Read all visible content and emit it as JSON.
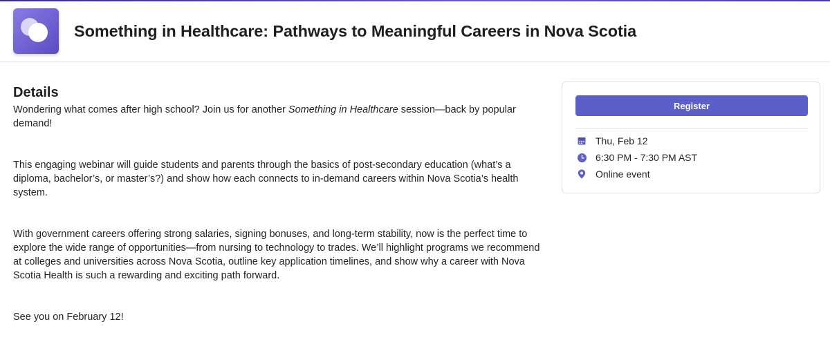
{
  "header": {
    "title": "Something in Healthcare: Pathways to Meaningful Careers in Nova Scotia",
    "logo_icon": "meeting-bubbles-icon"
  },
  "details": {
    "heading": "Details",
    "paragraphs": [
      {
        "before": "Wondering what comes after high school? Join us for another ",
        "emphasis": "Something in Healthcare",
        "after": " session—back by popular demand!"
      },
      "This engaging webinar will guide students and parents through the basics of post-secondary education (what’s a diploma, bachelor’s, or master’s?) and show how each connects to in-demand careers within Nova Scotia’s health system.",
      "With government careers offering strong salaries, signing bonuses, and long-term stability, now is the perfect time to explore the wide range of opportunities—from nursing to technology to trades. We’ll highlight programs we recommend at colleges and universities across Nova Scotia, outline key application timelines, and show why a career with Nova Scotia Health is such a rewarding and exciting path forward.",
      "See you on February 12!"
    ]
  },
  "event_card": {
    "register_label": "Register",
    "date": "Thu, Feb 12",
    "time": "6:30 PM - 7:30 PM AST",
    "location": "Online event",
    "icons": {
      "date": "calendar-icon",
      "time": "clock-icon",
      "location": "location-pin-icon"
    },
    "accent_color": "#5b5fc7"
  }
}
